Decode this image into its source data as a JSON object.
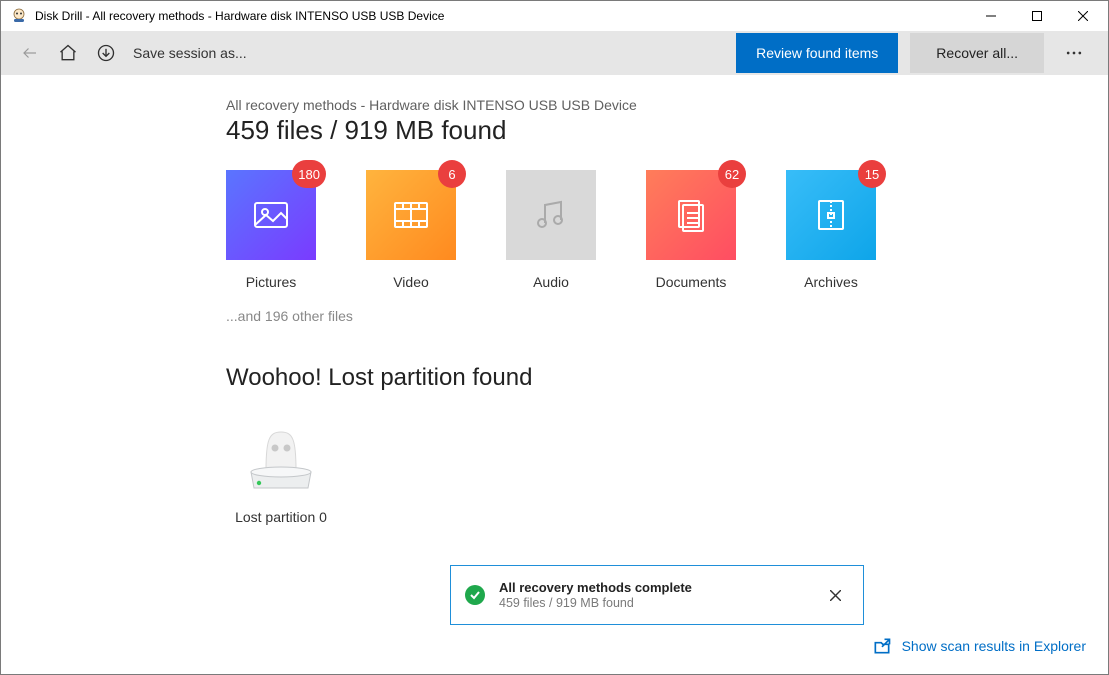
{
  "window": {
    "title": "Disk Drill - All recovery methods - Hardware disk INTENSO USB USB Device"
  },
  "toolbar": {
    "save_session_label": "Save session as...",
    "review_label": "Review found items",
    "recover_label": "Recover all..."
  },
  "results": {
    "breadcrumb": "All recovery methods - Hardware disk INTENSO USB USB Device",
    "headline": "459 files / 919 MB found",
    "other_files": "...and 196 other files",
    "partition_heading": "Woohoo! Lost partition found",
    "partition_label": "Lost partition 0"
  },
  "categories": [
    {
      "label": "Pictures",
      "count": "180"
    },
    {
      "label": "Video",
      "count": "6"
    },
    {
      "label": "Audio",
      "count": ""
    },
    {
      "label": "Documents",
      "count": "62"
    },
    {
      "label": "Archives",
      "count": "15"
    }
  ],
  "toast": {
    "title": "All recovery methods complete",
    "subtitle": "459 files / 919 MB found"
  },
  "footer": {
    "explorer_link": "Show scan results in Explorer"
  }
}
